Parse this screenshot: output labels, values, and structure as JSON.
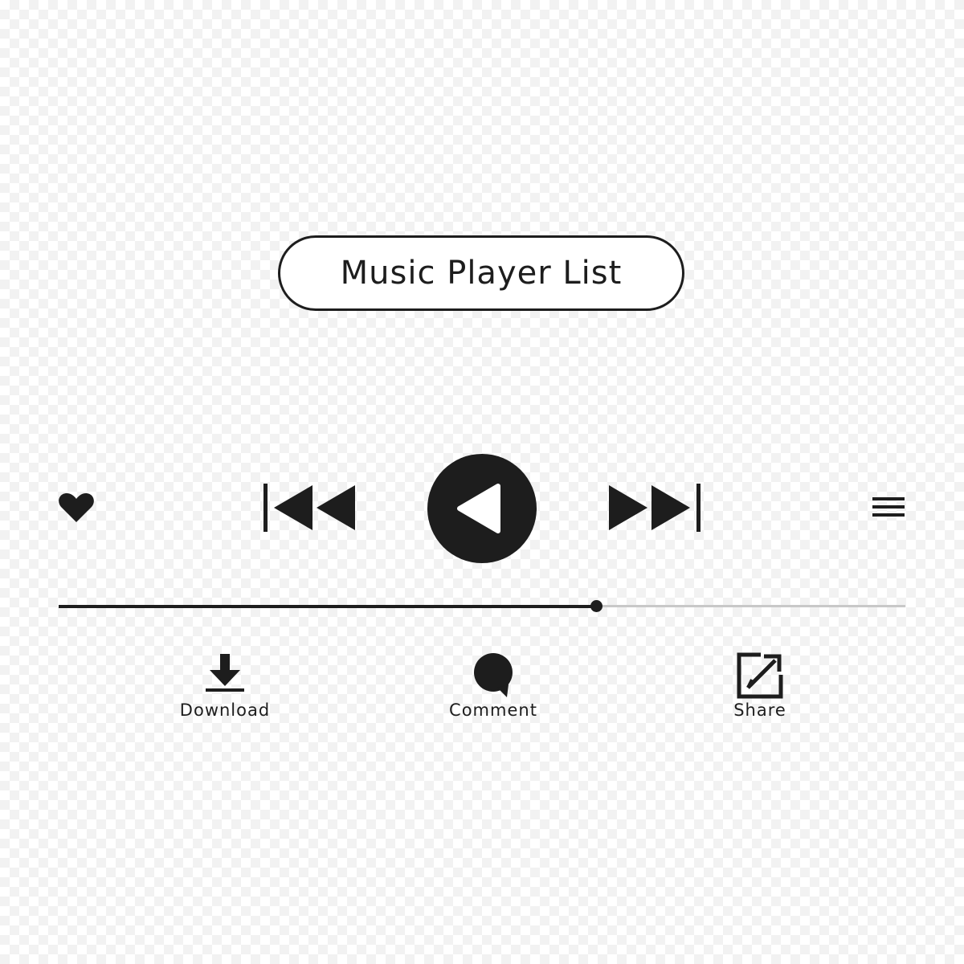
{
  "header": {
    "title": "Music Player List"
  },
  "controls": {
    "like_icon": "heart-icon",
    "previous_icon": "skip-previous-icon",
    "play_icon": "play-icon",
    "next_icon": "skip-next-icon",
    "menu_icon": "hamburger-menu-icon"
  },
  "progress": {
    "fraction": 0.635
  },
  "actions": [
    {
      "label": "Download",
      "icon": "download-icon"
    },
    {
      "label": "Comment",
      "icon": "comment-icon"
    },
    {
      "label": "Share",
      "icon": "share-icon"
    }
  ],
  "colors": {
    "foreground": "#1d1d1d",
    "track": "#c8c8c8",
    "background": "#ffffff"
  }
}
